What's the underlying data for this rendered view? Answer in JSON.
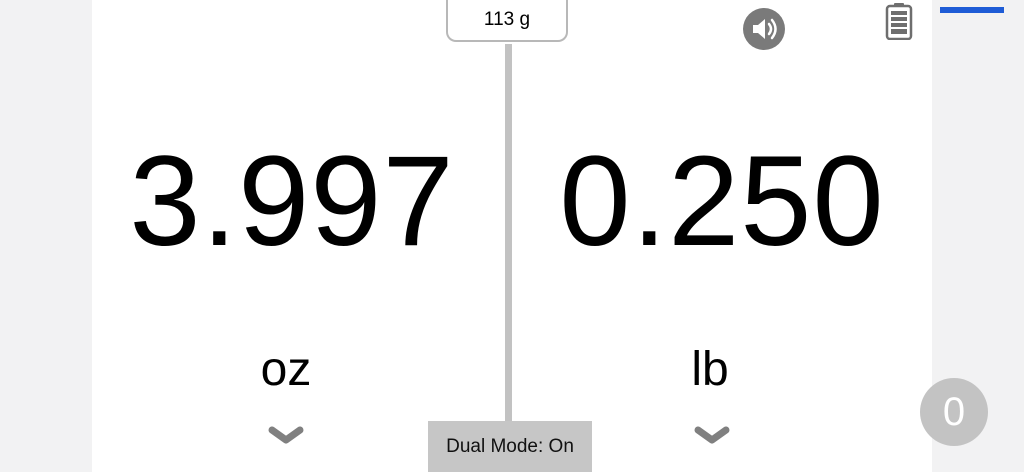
{
  "scale": {
    "weight_label": "113 g",
    "left": {
      "value": "3.997",
      "unit": "oz"
    },
    "right": {
      "value": "0.250",
      "unit": "lb"
    },
    "dual_mode_label": "Dual Mode: On",
    "tare_label": "0"
  },
  "icons": {
    "sound": "speaker-icon",
    "battery": "battery-icon",
    "menu": "menu-bar",
    "unit_picker": "chevron-down-icon"
  },
  "colors": {
    "accent": "#1e5cd6",
    "divider": "#c2c2c2",
    "button_gray": "#c6c6c6",
    "icon_gray": "#777777"
  }
}
